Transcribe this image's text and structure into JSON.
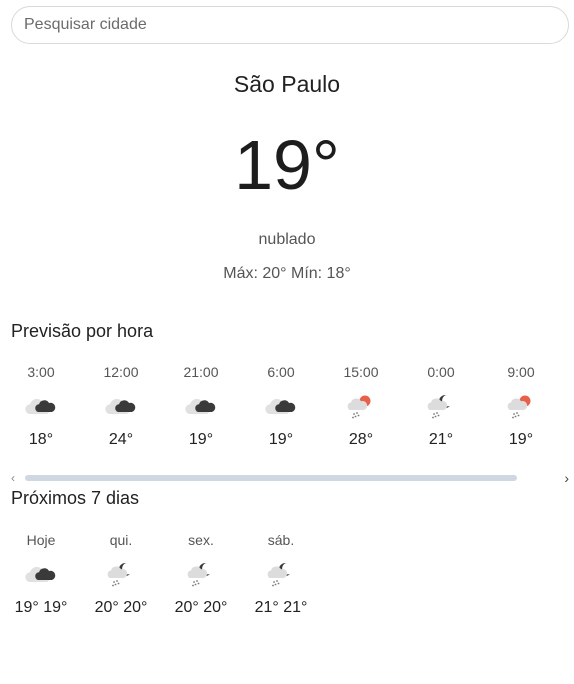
{
  "search": {
    "placeholder": "Pesquisar cidade"
  },
  "current": {
    "city": "São Paulo",
    "temperature": "19°",
    "condition": "nublado",
    "max_min": "Máx: 20° Mín: 18°"
  },
  "hourly": {
    "title": "Previsão por hora",
    "items": [
      {
        "time": "3:00",
        "icon": "cloudy-night-icon",
        "temp": "18°"
      },
      {
        "time": "12:00",
        "icon": "cloudy-night-icon",
        "temp": "24°"
      },
      {
        "time": "21:00",
        "icon": "cloudy-night-icon",
        "temp": "19°"
      },
      {
        "time": "6:00",
        "icon": "cloudy-night-icon",
        "temp": "19°"
      },
      {
        "time": "15:00",
        "icon": "sun-rain-icon",
        "temp": "28°"
      },
      {
        "time": "0:00",
        "icon": "moon-rain-icon",
        "temp": "21°"
      },
      {
        "time": "9:00",
        "icon": "sun-rain-icon",
        "temp": "19°"
      }
    ]
  },
  "daily": {
    "title": "Próximos 7 dias",
    "items": [
      {
        "day": "Hoje",
        "icon": "cloudy-night-icon",
        "temps": "19° 19°"
      },
      {
        "day": "qui.",
        "icon": "moon-rain-icon",
        "temps": "20° 20°"
      },
      {
        "day": "sex.",
        "icon": "moon-rain-icon",
        "temps": "20° 20°"
      },
      {
        "day": "sáb.",
        "icon": "moon-rain-icon",
        "temps": "21° 21°"
      }
    ]
  },
  "scroll": {
    "left_arrow": "‹",
    "right_arrow": "›"
  },
  "colors": {
    "sun": "#e8604c",
    "moon": "#3a3a3a",
    "cloud": "#dcdcdc",
    "rain": "#777777"
  }
}
